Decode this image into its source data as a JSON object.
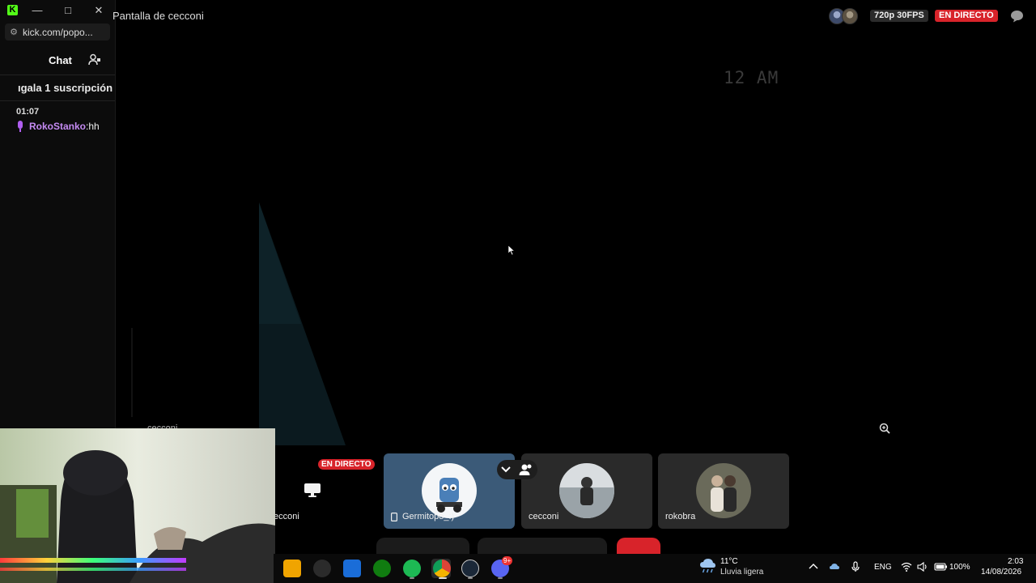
{
  "chat_window": {
    "kick_logo": "K",
    "url": "kick.com/popo...",
    "chat_title": "Chat",
    "sub_banner": "ıgala 1 suscripción",
    "message": {
      "time": "01:07",
      "user": "RokoStanko",
      "sep": ": ",
      "text": "hh"
    }
  },
  "stream": {
    "screen_title": "Pantalla de cecconi",
    "quality": "720p 30FPS",
    "live_label": "EN DIRECTO",
    "clock_text": "12 AM",
    "stream_tag": "cecconi"
  },
  "participants": {
    "screen_tile_name": "ecconi",
    "mini_live": "EN DIRECTO",
    "tiles": [
      {
        "name": "Germitopo_:)",
        "has_phone_icon": true
      },
      {
        "name": "cecconi",
        "has_phone_icon": false
      },
      {
        "name": "rokobra",
        "has_phone_icon": false
      }
    ]
  },
  "taskbar": {
    "weather_temp": "11°C",
    "weather_desc": "Lluvia ligera",
    "language": "ENG",
    "battery": "100%",
    "time": "2:03",
    "date": "14/08/2026",
    "discord_badge": "9+",
    "icons": [
      "windows-store-icon",
      "obs-icon",
      "editor-icon",
      "xbox-icon",
      "spotify-icon",
      "chrome-icon",
      "steam-icon",
      "discord-icon"
    ]
  }
}
